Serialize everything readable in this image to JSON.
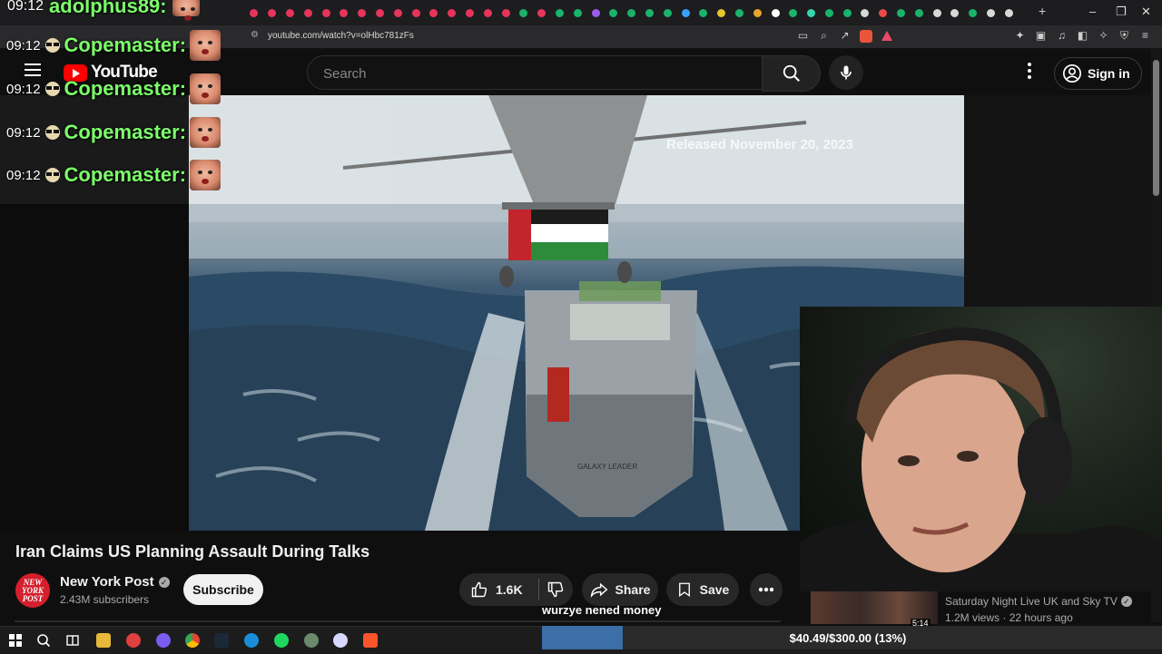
{
  "browser": {
    "url": "youtube.com/watch?v=olHbc781zFs",
    "tab_dot_colors": [
      "#e8345a",
      "#e8345a",
      "#e8345a",
      "#e8345a",
      "#e8345a",
      "#e8345a",
      "#e8345a",
      "#e8345a",
      "#e8345a",
      "#e8345a",
      "#e8345a",
      "#e8345a",
      "#e8345a",
      "#e8345a",
      "#e8345a",
      "#1ab36a",
      "#e8345a",
      "#1ab36a",
      "#1ab36a",
      "#9c5cf0",
      "#1ab36a",
      "#1ab36a",
      "#1ab36a",
      "#1ab36a",
      "#3aa0ff",
      "#1ab36a",
      "#e3c52c",
      "#1ab36a",
      "#e8a42c",
      "#ffffff",
      "#1ab36a",
      "#33d6b0",
      "#1ab36a",
      "#1ab36a",
      "#d8d8d8",
      "#e84a4a",
      "#1ab36a",
      "#1ab36a",
      "#d8d8d8",
      "#d8d8d8",
      "#1ab36a",
      "#d8d8d8",
      "#d8d8d8"
    ],
    "new_tab_label": "+",
    "window_controls": [
      "–",
      "❐",
      "✕"
    ]
  },
  "youtube": {
    "logo_text": "YouTube",
    "search_placeholder": "Search",
    "sign_in_label": "Sign in"
  },
  "chat": {
    "top_time": "09:12",
    "top_user": "adolphus89:",
    "messages": [
      {
        "time": "09:12",
        "user": "Copemaster:"
      },
      {
        "time": "09:12",
        "user": "Copemaster:"
      },
      {
        "time": "09:12",
        "user": "Copemaster:"
      },
      {
        "time": "09:12",
        "user": "Copemaster:"
      }
    ]
  },
  "video": {
    "overlay_text": "Released November 20, 2023",
    "ship_text": "GALAXY LEADER",
    "title": "Iran Claims US Planning Assault During Talks",
    "channel_name": "New York Post",
    "channel_avatar_text": "NEW YORK POST",
    "subscribers": "2.43M subscribers",
    "subscribe_label": "Subscribe",
    "like_count": "1.6K",
    "share_label": "Share",
    "save_label": "Save"
  },
  "stream": {
    "chat_message": "wurzye nened money",
    "donation_text": "$40.49/$300.00 (13%)",
    "donation_progress": 0.13
  },
  "recommendation": {
    "channel": "Saturday Night Live UK and Sky TV",
    "views": "1.2M views",
    "age": "22 hours ago",
    "separator": "·",
    "duration": "5:14"
  },
  "colors": {
    "accent_red": "#ff0000",
    "chat_name_green": "#7dff6b",
    "donation_fill": "#3c6ea8"
  }
}
